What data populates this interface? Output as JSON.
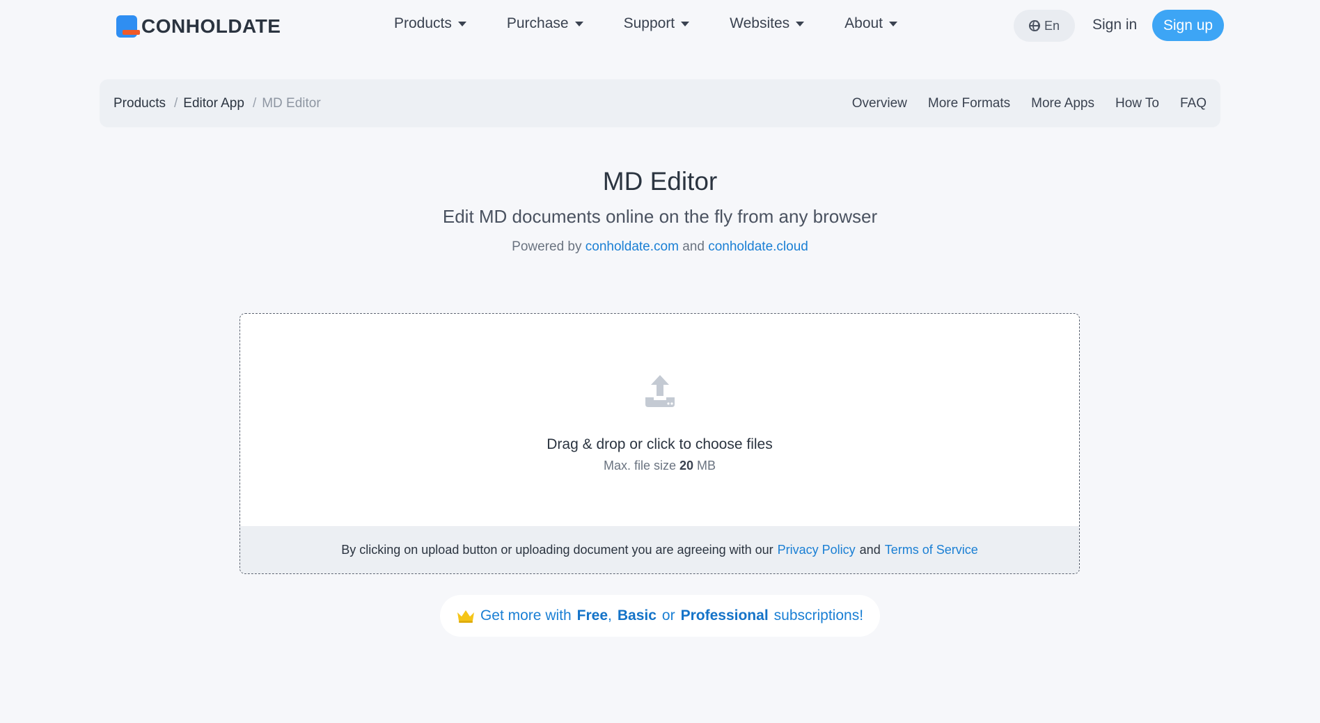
{
  "brand": {
    "name": "CONHOLDATE",
    "accent": "#2f8ef2",
    "stripe": "#f05a28"
  },
  "nav": {
    "items": [
      {
        "label": "Products"
      },
      {
        "label": "Purchase"
      },
      {
        "label": "Support"
      },
      {
        "label": "Websites"
      },
      {
        "label": "About"
      }
    ],
    "language": "En",
    "signin": "Sign in",
    "signup": "Sign up"
  },
  "breadcrumb": {
    "items": [
      "Products",
      "Editor App"
    ],
    "current": "MD Editor",
    "separator": "/"
  },
  "subnav": [
    "Overview",
    "More Formats",
    "More Apps",
    "How To",
    "FAQ"
  ],
  "hero": {
    "title": "MD Editor",
    "subtitle": "Edit MD documents online on the fly from any browser",
    "powered_prefix": "Powered by",
    "link1": "conholdate.com",
    "and": "and",
    "link2": "conholdate.cloud"
  },
  "upload": {
    "drop_text": "Drag & drop or click to choose files",
    "max_prefix": "Max. file size",
    "max_value": "20",
    "max_unit": "MB",
    "agree_prefix": "By clicking on upload button or uploading document you are agreeing with our",
    "privacy": "Privacy Policy",
    "and": "and",
    "terms": "Terms of Service"
  },
  "promo": {
    "prefix": "Get more with",
    "plan1": "Free",
    "comma": ",",
    "plan2": "Basic",
    "or": "or",
    "plan3": "Professional",
    "suffix": "subscriptions!"
  },
  "colors": {
    "link": "#1a7fd4",
    "signup_bg": "#3da5f5",
    "page_bg": "#f6f7fa"
  },
  "icons": [
    "globe-icon",
    "upload-icon",
    "crown-icon",
    "caret-down-icon"
  ]
}
